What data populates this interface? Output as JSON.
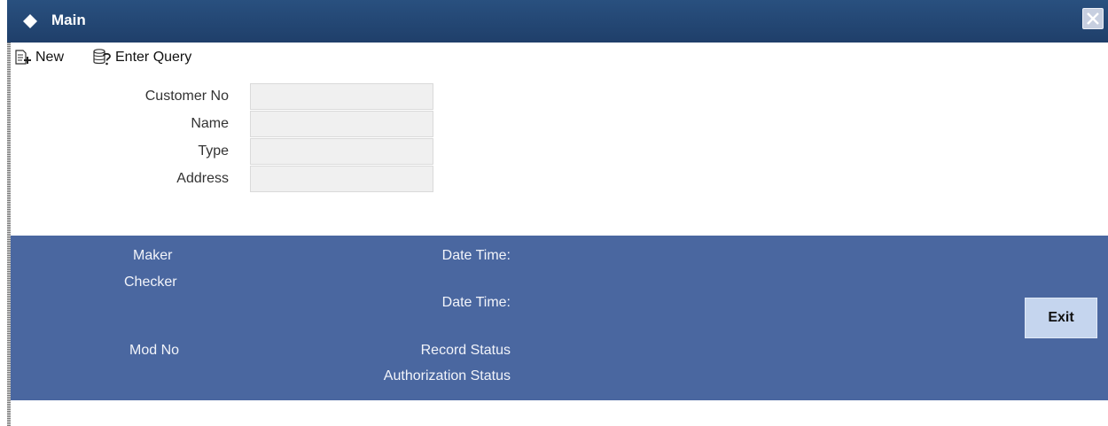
{
  "window": {
    "title": "Main"
  },
  "toolbar": {
    "new_label": "New",
    "enter_query_label": "Enter Query"
  },
  "form": {
    "fields": [
      {
        "label": "Customer No",
        "value": ""
      },
      {
        "label": "Name",
        "value": ""
      },
      {
        "label": "Type",
        "value": ""
      },
      {
        "label": "Address",
        "value": ""
      }
    ]
  },
  "audit": {
    "maker_label": "Maker",
    "checker_label": "Checker",
    "maker_date_time_label": "Date Time:",
    "checker_date_time_label": "Date Time:",
    "mod_no_label": "Mod No",
    "record_status_label": "Record Status",
    "authorization_status_label": "Authorization Status",
    "exit_label": "Exit"
  },
  "colors": {
    "titlebar": "#1f3f6a",
    "audit_panel": "#4a67a0",
    "exit_button": "#c5d5ee",
    "input_background": "#f0f0f0"
  }
}
